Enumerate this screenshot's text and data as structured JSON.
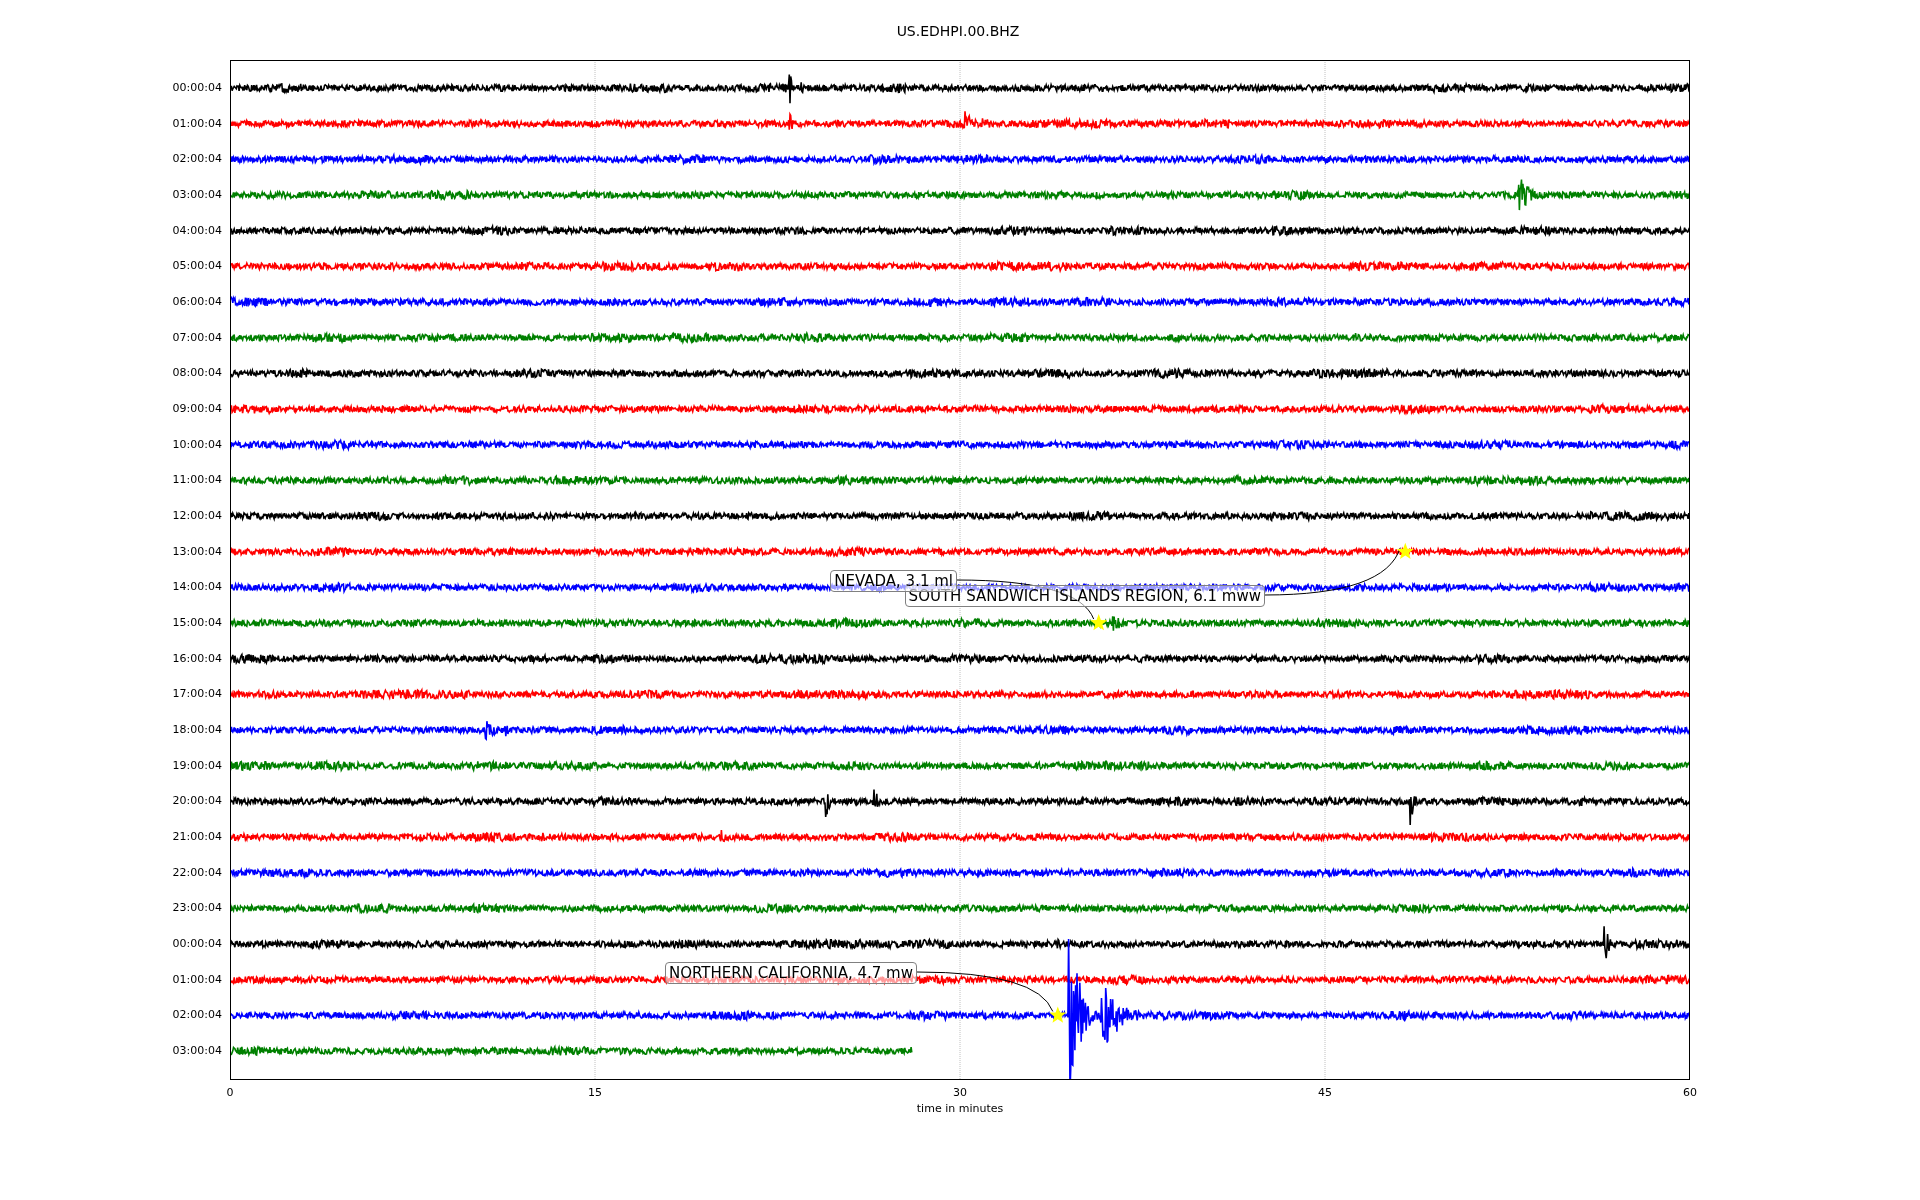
{
  "title": "US.EDHPI.00.BHZ",
  "plot": {
    "xlabel": "time in minutes",
    "xticks": [
      "0",
      "15",
      "30",
      "45",
      "60"
    ],
    "rows": [
      {
        "label": "00:00:04",
        "color": "#000000",
        "level": 1
      },
      {
        "label": "01:00:04",
        "color": "#ff0000",
        "level": 1
      },
      {
        "label": "02:00:04",
        "color": "#0000ff",
        "level": 1
      },
      {
        "label": "03:00:04",
        "color": "#008000",
        "level": 1
      },
      {
        "label": "04:00:04",
        "color": "#000000",
        "level": 1
      },
      {
        "label": "05:00:04",
        "color": "#ff0000",
        "level": 1
      },
      {
        "label": "06:00:04",
        "color": "#0000ff",
        "level": 1
      },
      {
        "label": "07:00:04",
        "color": "#008000",
        "level": 1
      },
      {
        "label": "08:00:04",
        "color": "#000000",
        "level": 1
      },
      {
        "label": "09:00:04",
        "color": "#ff0000",
        "level": 1
      },
      {
        "label": "10:00:04",
        "color": "#0000ff",
        "level": 1
      },
      {
        "label": "11:00:04",
        "color": "#008000",
        "level": 1
      },
      {
        "label": "12:00:04",
        "color": "#000000",
        "level": 1
      },
      {
        "label": "13:00:04",
        "color": "#ff0000",
        "level": 1,
        "events": [
          {
            "label": "SOUTH SANDWICH ISLANDS REGION, 6.1 mww",
            "level": 0.805
          }
        ]
      },
      {
        "label": "14:00:04",
        "color": "#0000ff",
        "level": 1
      },
      {
        "label": "15:00:04",
        "color": "#008000",
        "level": 1,
        "events": [
          {
            "label": "NEVADA, 3.1 ml",
            "level": 0.595
          }
        ]
      },
      {
        "label": "16:00:04",
        "color": "#000000",
        "level": 1
      },
      {
        "label": "17:00:04",
        "color": "#ff0000",
        "level": 1
      },
      {
        "label": "18:00:04",
        "color": "#0000ff",
        "level": 1
      },
      {
        "label": "19:00:04",
        "color": "#008000",
        "level": 1
      },
      {
        "label": "20:00:04",
        "color": "#000000",
        "level": 1
      },
      {
        "label": "21:00:04",
        "color": "#ff0000",
        "level": 1
      },
      {
        "label": "22:00:04",
        "color": "#0000ff",
        "level": 1
      },
      {
        "label": "23:00:04",
        "color": "#008000",
        "level": 1
      },
      {
        "label": "00:00:04",
        "color": "#000000",
        "level": 1
      },
      {
        "label": "01:00:04",
        "color": "#ff0000",
        "level": 1
      },
      {
        "label": "02:00:04",
        "color": "#0000ff",
        "level": 1,
        "events": [
          {
            "label": "NORTHERN CALIFORNIA, 4.7 mw",
            "level": 0.567
          }
        ]
      },
      {
        "label": "03:00:04",
        "color": "#008000",
        "level": 0.467
      }
    ]
  }
}
